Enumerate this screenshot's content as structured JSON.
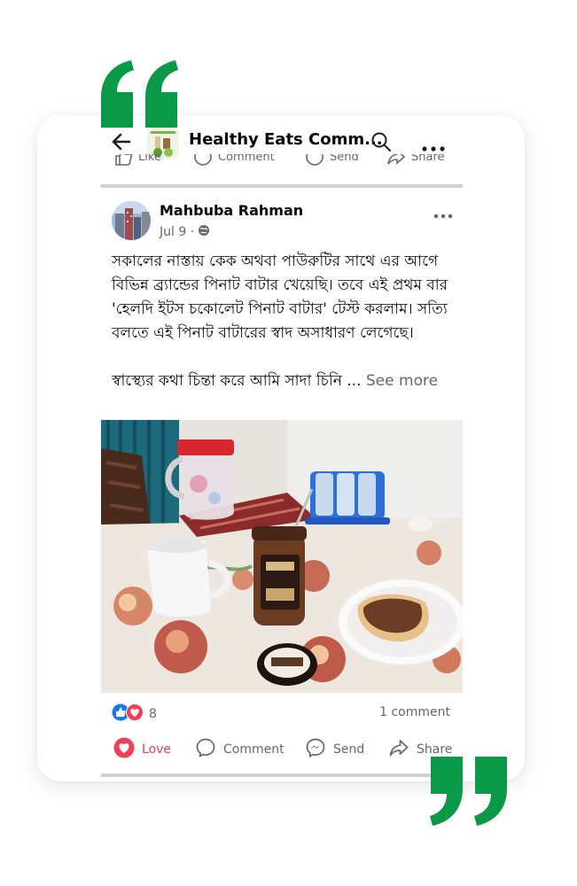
{
  "header": {
    "group_title": "Healthy Eats Comm..."
  },
  "previous_post_actions": [
    "Like",
    "Comment",
    "Send",
    "Share"
  ],
  "post": {
    "author": "Mahbuba Rahman",
    "date": "Jul 9 ·",
    "text_paragraph_1": "সকালের নাস্তায় কেক অথবা পাউরুটির সাথে এর আগে বিভিন্ন ব্র্যান্ডের পিনাট বাটার খেয়েছি। তবে এই প্রথম বার 'হেলদি ইটস চকোলেট পিনাট বাটার' টেস্ট করলাম। সত্যি বলতে এই পিনাট বাটারের স্বাদ অসাধারণ লেগেছে।",
    "text_paragraph_2": "স্বাস্থ্যের কথা চিন্তা করে আমি সাদা চিনি ...",
    "see_more": "See more",
    "reaction_count": "8",
    "comment_count": "1 comment"
  },
  "actions": {
    "love": "Love",
    "comment": "Comment",
    "send": "Send",
    "share": "Share"
  },
  "colors": {
    "quote_green": "#0a9a47",
    "love_red": "#e4405f",
    "like_blue": "#1877f2",
    "divider": "#ced0d4",
    "muted_text": "#65676b"
  },
  "icons": [
    "back-arrow-icon",
    "search-icon",
    "more-icon",
    "globe-icon",
    "like-reaction-icon",
    "love-reaction-icon",
    "heart-icon",
    "comment-icon",
    "messenger-icon",
    "share-icon",
    "quote-icon"
  ]
}
